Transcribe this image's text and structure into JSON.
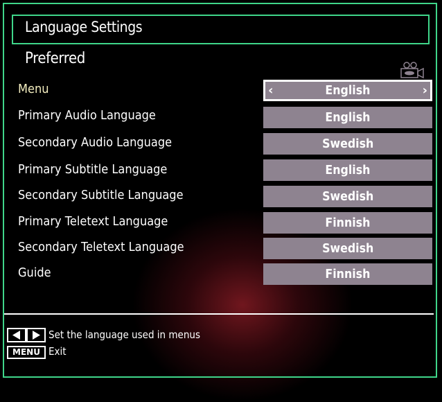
{
  "header": {
    "title": "Language Settings"
  },
  "section": {
    "title": "Preferred"
  },
  "icons": {
    "camera": "video-camera-icon"
  },
  "settings": [
    {
      "label": "Menu",
      "value": "English",
      "selected": true
    },
    {
      "label": "Primary Audio Language",
      "value": "English"
    },
    {
      "label": "Secondary Audio Language",
      "value": "Swedish"
    },
    {
      "label": "Primary Subtitle Language",
      "value": "English"
    },
    {
      "label": "Secondary Subtitle Language",
      "value": "Swedish"
    },
    {
      "label": "Primary Teletext Language",
      "value": "Finnish"
    },
    {
      "label": "Secondary Teletext Language",
      "value": "Swedish"
    },
    {
      "label": "Guide",
      "value": "Finnish"
    }
  ],
  "selector_arrows": {
    "left": "‹",
    "right": "›"
  },
  "footer": {
    "hint_arrows": "Set the language used in menus",
    "menu_key": "MENU",
    "hint_menu": "Exit"
  },
  "colors": {
    "accent": "#3fd68a",
    "value_bg": "#8e8390",
    "active_label": "#f3edbf"
  }
}
